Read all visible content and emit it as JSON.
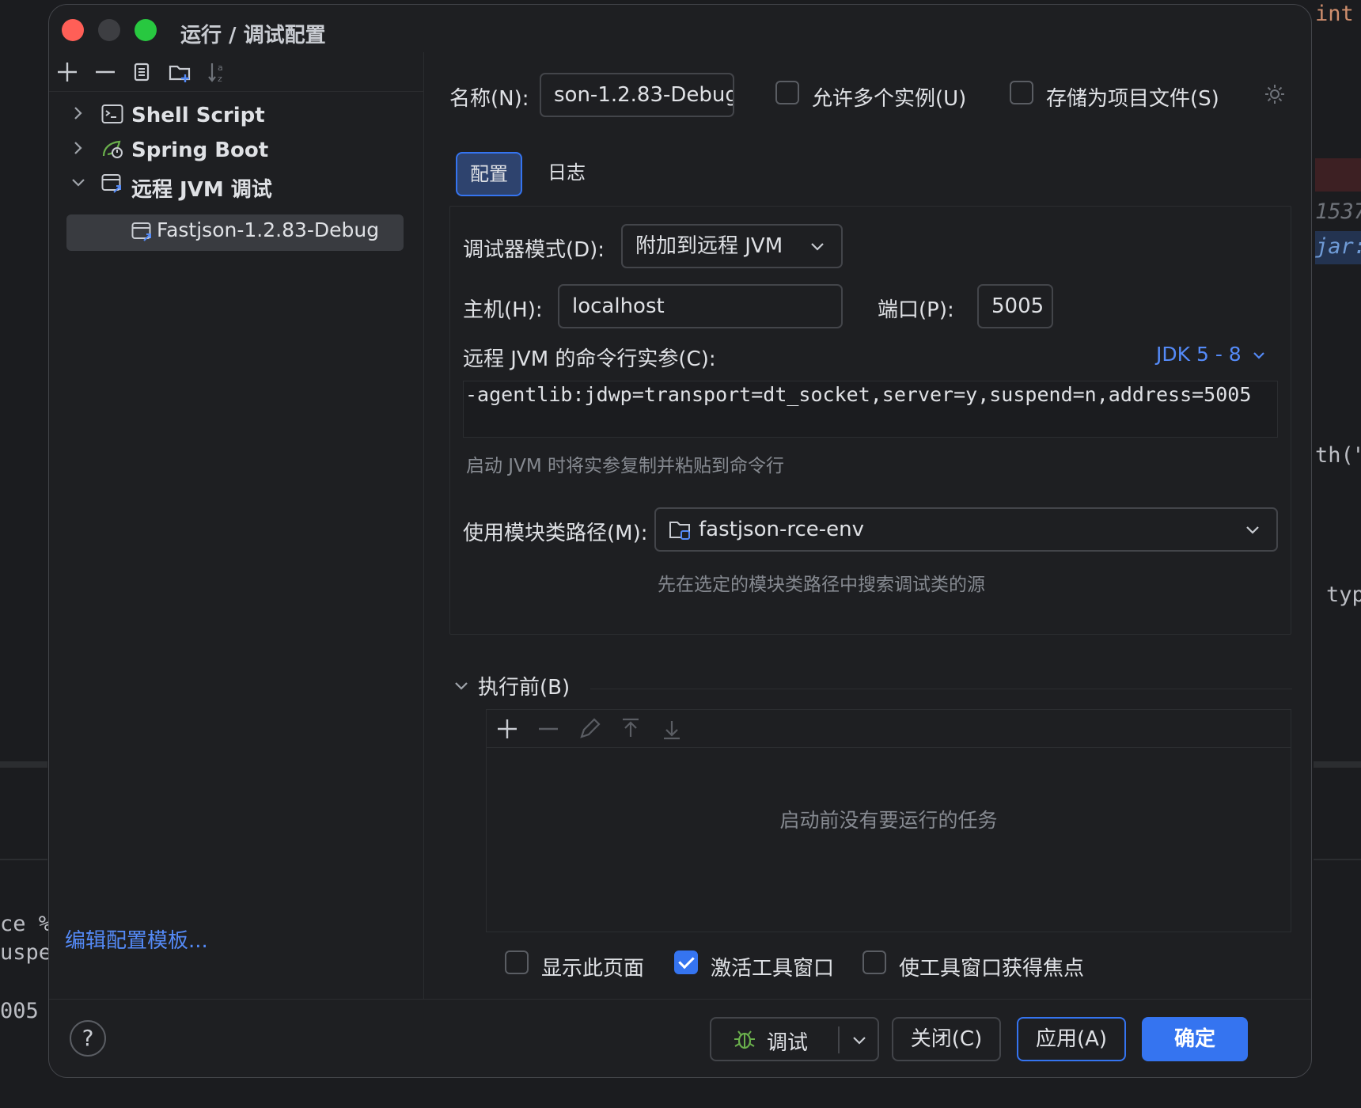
{
  "background": {
    "code_fragments": [
      "int",
      "1537",
      "jar:",
      "th(\"",
      "typ",
      "ce %",
      "uspe",
      "005"
    ]
  },
  "dialog": {
    "title": "运行 / 调试配置"
  },
  "tree": {
    "items": [
      {
        "label": "Shell Script",
        "expanded": false
      },
      {
        "label": "Spring Boot",
        "expanded": false
      },
      {
        "label": "远程 JVM 调试",
        "expanded": true
      }
    ],
    "selected_child": "Fastjson-1.2.83-Debug"
  },
  "left_footer": {
    "edit_templates": "编辑配置模板..."
  },
  "form": {
    "name_label": "名称(N):",
    "name_value": "son-1.2.83-Debug",
    "allow_multiple_label": "允许多个实例(U)",
    "store_as_project_label": "存储为项目文件(S)",
    "tabs": [
      {
        "label": "配置",
        "active": true
      },
      {
        "label": "日志",
        "active": false
      }
    ],
    "debugger_mode_label": "调试器模式(D):",
    "debugger_mode_value": "附加到远程 JVM",
    "host_label": "主机(H):",
    "host_value": "localhost",
    "port_label": "端口(P):",
    "port_value": "5005",
    "cmd_label": "远程 JVM 的命令行实参(C):",
    "jdk_selector": "JDK 5 - 8",
    "cmd_value": "-agentlib:jdwp=transport=dt_socket,server=y,suspend=n,address=5005",
    "cmd_hint": "启动 JVM 时将实参复制并粘贴到命令行",
    "module_label": "使用模块类路径(M):",
    "module_value": "fastjson-rce-env",
    "module_hint": "先在选定的模块类路径中搜索调试类的源"
  },
  "before_launch": {
    "title": "执行前(B)",
    "empty_text": "启动前没有要运行的任务",
    "show_page_label": "显示此页面",
    "show_page_checked": false,
    "activate_tool_window_label": "激活工具窗口",
    "activate_tool_window_checked": true,
    "focus_tool_window_label": "使工具窗口获得焦点",
    "focus_tool_window_checked": false
  },
  "buttons": {
    "help": "?",
    "debug": "调试",
    "close": "关闭(C)",
    "apply": "应用(A)",
    "ok": "确定"
  },
  "colors": {
    "accent": "#3574f0",
    "link": "#548af7",
    "panel_bg": "#1e1f22"
  }
}
